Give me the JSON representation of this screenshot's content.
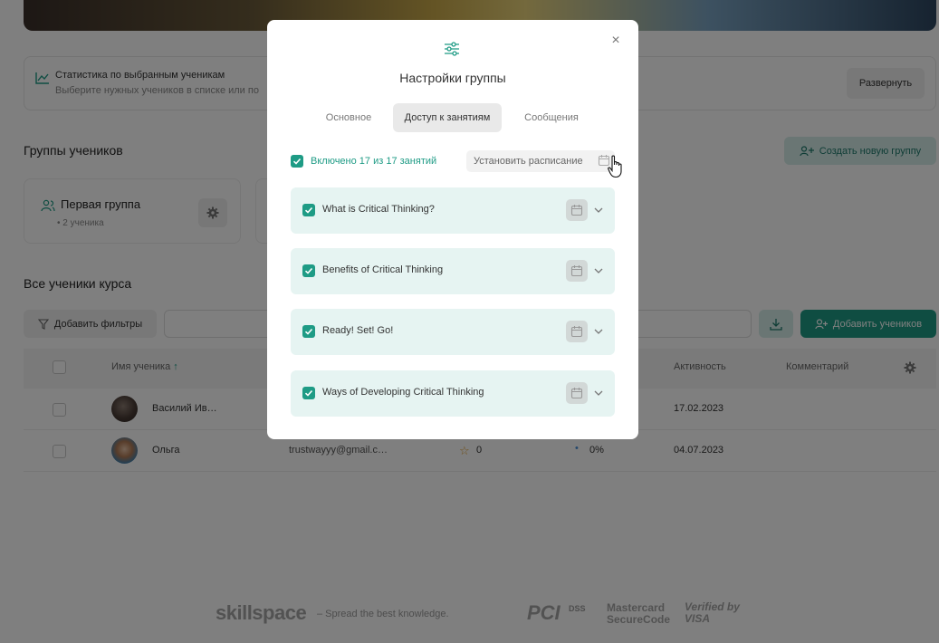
{
  "page": {
    "stats": {
      "title": "Статистика по выбранным ученикам",
      "subtitle": "Выберите нужных учеников в списке или по",
      "expand_label": "Развернуть"
    },
    "groups_heading": "Группы учеников",
    "create_group_label": "Создать новую группу",
    "groups": [
      {
        "name": "Первая группа",
        "count": "2 ученика"
      }
    ],
    "all_students_heading": "Все ученики курса",
    "filter_label": "Добавить фильтры",
    "add_students_label": "Добавить учеников",
    "table": {
      "columns": {
        "name": "Имя ученика",
        "activity": "Активность",
        "comment": "Комментарий"
      },
      "rows": [
        {
          "name": "Василий Ив…",
          "email": "",
          "stars": "",
          "progress": "",
          "activity": "17.02.2023"
        },
        {
          "name": "Ольга",
          "email": "trustwayyy@gmail.c…",
          "stars": "0",
          "progress": "0%",
          "activity": "04.07.2023"
        }
      ]
    },
    "footer": {
      "logo": "skillspace",
      "slogan": "– Spread the best knowledge.",
      "pci": "PCI",
      "dss": "DSS",
      "mc_line1": "Mastercard",
      "mc_line2": "SecureCode",
      "visa_line1": "Verified by",
      "visa_line2": "VISA"
    }
  },
  "modal": {
    "title": "Настройки группы",
    "close": "×",
    "tabs": [
      {
        "label": "Основное",
        "active": false
      },
      {
        "label": "Доступ к занятиям",
        "active": true
      },
      {
        "label": "Сообщения",
        "active": false
      }
    ],
    "included_text": "Включено 17 из 17 занятий",
    "schedule_label": "Установить расписание",
    "lessons": [
      {
        "title": "What is Critical Thinking?",
        "checked": true
      },
      {
        "title": "Benefits of Critical Thinking",
        "checked": true
      },
      {
        "title": "Ready! Set! Go!",
        "checked": true
      },
      {
        "title": "Ways of Developing Critical Thinking",
        "checked": true
      }
    ]
  },
  "colors": {
    "accent": "#1e9b85",
    "accent_light": "#e6f4f2"
  }
}
